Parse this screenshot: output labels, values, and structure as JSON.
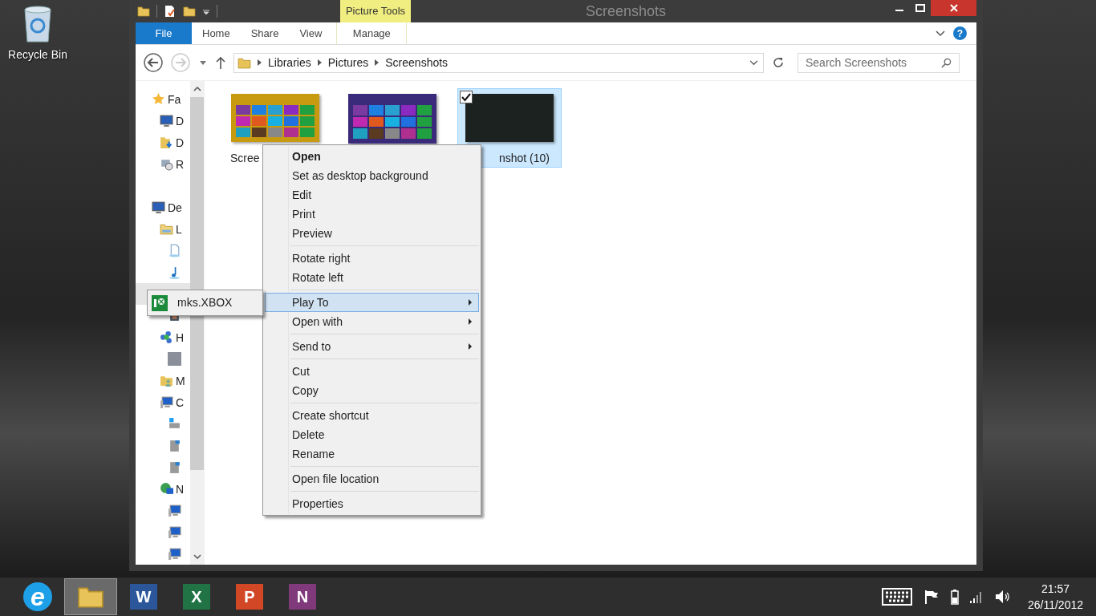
{
  "desktop_icons": [
    {
      "label": "Recycle Bin"
    }
  ],
  "window": {
    "title": "Screenshots",
    "contextual_group": "Picture Tools",
    "ribbon_tabs": [
      {
        "label": "File",
        "kind": "file"
      },
      {
        "label": "Home",
        "kind": "tab"
      },
      {
        "label": "Share",
        "kind": "tab"
      },
      {
        "label": "View",
        "kind": "tab"
      },
      {
        "label": "Manage",
        "kind": "contextual"
      }
    ],
    "help": "?",
    "breadcrumbs": [
      "Libraries",
      "Pictures",
      "Screenshots"
    ],
    "search": {
      "placeholder": "Search Screenshots"
    },
    "nav": [
      {
        "label": "Fa",
        "hovered": false,
        "children": [
          {
            "label": "D",
            "hovered": false
          },
          {
            "label": "D",
            "hovered": false
          },
          {
            "label": "R",
            "hovered": false
          }
        ]
      },
      {
        "label": "De",
        "hovered": false,
        "children": [
          {
            "label": "L",
            "hovered": false,
            "children": [
              {
                "hovered": false
              },
              {
                "hovered": false
              },
              {
                "hovered": true
              },
              {
                "hovered": false
              }
            ]
          },
          {
            "label": "H",
            "hovered": false,
            "children": [
              {
                "hovered": false
              }
            ]
          },
          {
            "label": "M",
            "hovered": false
          },
          {
            "label": "C",
            "hovered": false,
            "children": [
              {
                "hovered": false
              },
              {
                "hovered": false
              },
              {
                "hovered": false
              }
            ]
          },
          {
            "label": "N",
            "hovered": false,
            "children": [
              {
                "hovered": false
              },
              {
                "hovered": false
              },
              {
                "hovered": false
              }
            ]
          }
        ]
      }
    ],
    "files": [
      {
        "label": "Scree",
        "kind": "tiles",
        "selected": false
      },
      {
        "kind": "tiles",
        "selected": false
      },
      {
        "label": "nshot (10)",
        "kind": "photo",
        "selected": true
      }
    ]
  },
  "context_menu": {
    "groups": [
      [
        {
          "label": "Open",
          "default": true,
          "submenu": false,
          "selected": false
        },
        {
          "label": "Set as desktop background",
          "default": false,
          "submenu": false,
          "selected": false
        },
        {
          "label": "Edit",
          "default": false,
          "submenu": false,
          "selected": false
        },
        {
          "label": "Print",
          "default": false,
          "submenu": false,
          "selected": false
        },
        {
          "label": "Preview",
          "default": false,
          "submenu": false,
          "selected": false
        }
      ],
      [
        {
          "label": "Rotate right",
          "default": false,
          "submenu": false,
          "selected": false
        },
        {
          "label": "Rotate left",
          "default": false,
          "submenu": false,
          "selected": false
        }
      ],
      [
        {
          "label": "Play To",
          "default": false,
          "submenu": true,
          "selected": true
        },
        {
          "label": "Open with",
          "default": false,
          "submenu": true,
          "selected": false
        }
      ],
      [
        {
          "label": "Send to",
          "default": false,
          "submenu": true,
          "selected": false
        }
      ],
      [
        {
          "label": "Cut",
          "default": false,
          "submenu": false,
          "selected": false
        },
        {
          "label": "Copy",
          "default": false,
          "submenu": false,
          "selected": false
        }
      ],
      [
        {
          "label": "Create shortcut",
          "default": false,
          "submenu": false,
          "selected": false
        },
        {
          "label": "Delete",
          "default": false,
          "submenu": false,
          "selected": false
        },
        {
          "label": "Rename",
          "default": false,
          "submenu": false,
          "selected": false
        }
      ],
      [
        {
          "label": "Open file location",
          "default": false,
          "submenu": false,
          "selected": false
        }
      ],
      [
        {
          "label": "Properties",
          "default": false,
          "submenu": false,
          "selected": false
        }
      ]
    ]
  },
  "submenu": {
    "items": [
      {
        "label": "mks.XBOX"
      }
    ]
  },
  "taskbar": {
    "apps": [
      {
        "kind": "browser",
        "letter": "e",
        "selected": false
      },
      {
        "kind": "folder",
        "selected": true
      },
      {
        "kind": "office",
        "letter": "W",
        "color": "#2b579a",
        "selected": false
      },
      {
        "kind": "office",
        "letter": "X",
        "color": "#217346",
        "selected": false
      },
      {
        "kind": "office",
        "letter": "P",
        "color": "#d24726",
        "selected": false
      },
      {
        "kind": "office",
        "letter": "N",
        "color": "#80397b",
        "selected": false
      }
    ],
    "time": "21:57",
    "date": "26/11/2012"
  }
}
